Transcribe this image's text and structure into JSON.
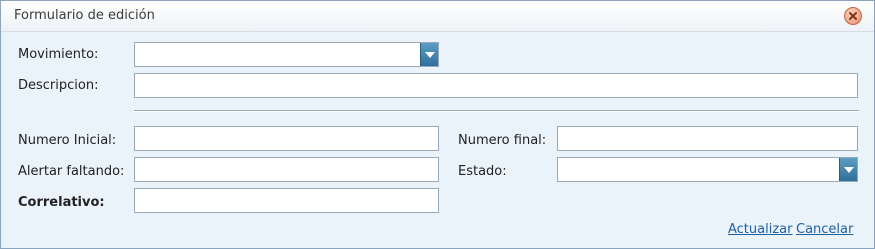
{
  "window": {
    "title": "Formulario de edición"
  },
  "form": {
    "movimiento": {
      "label": "Movimiento:",
      "value": ""
    },
    "descripcion": {
      "label": "Descripcion:",
      "value": ""
    },
    "numero_inicial": {
      "label": "Numero Inicial:",
      "value": ""
    },
    "numero_final": {
      "label": "Numero final:",
      "value": ""
    },
    "alertar_faltando": {
      "label": "Alertar faltando:",
      "value": ""
    },
    "estado": {
      "label": "Estado:",
      "value": ""
    },
    "correlativo": {
      "label": "Correlativo:",
      "value": ""
    }
  },
  "actions": {
    "update_label": "Actualizar",
    "cancel_label": "Cancelar"
  },
  "colors": {
    "accent": "#2f6f9a",
    "link": "#1f5f9e",
    "window_bg": "#eaf2fa"
  },
  "icons": {
    "close": "close-icon",
    "dropdown": "chevron-down-icon"
  }
}
